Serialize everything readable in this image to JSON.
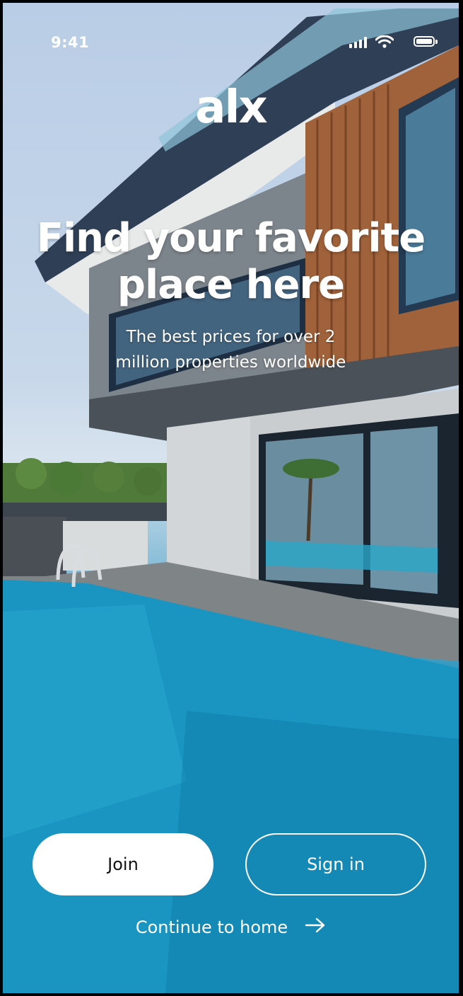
{
  "status_bar": {
    "time": "9:41"
  },
  "brand": {
    "logo": "alx"
  },
  "hero": {
    "headline_line1": "Find your favorite",
    "headline_line2": "place here",
    "subtitle_line1": "The best prices for over 2",
    "subtitle_line2": "million properties worldwide"
  },
  "actions": {
    "join_label": "Join",
    "signin_label": "Sign in",
    "continue_label": "Continue to home"
  },
  "icons": {
    "signal": "cellular-signal-icon",
    "wifi": "wifi-icon",
    "battery": "battery-icon",
    "continue": "arrow-right-icon"
  },
  "colors": {
    "pool_blue": "#1f8fb8",
    "sky_blue": "#b9cde6",
    "wood": "#a0623a",
    "button_white": "#ffffff"
  }
}
